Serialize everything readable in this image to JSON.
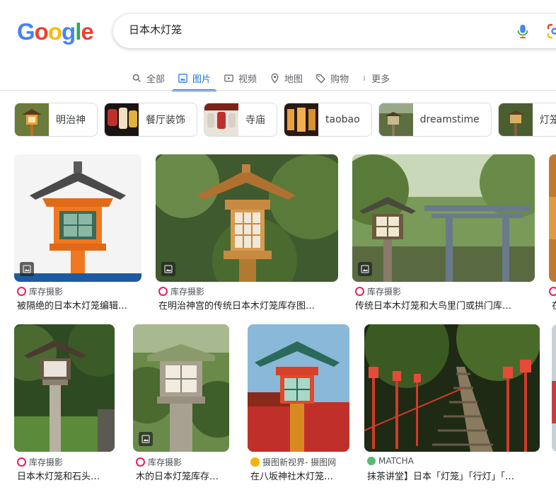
{
  "logo": {
    "letters": [
      "G",
      "o",
      "o",
      "g",
      "l",
      "e"
    ],
    "colors": [
      "#4285F4",
      "#EA4335",
      "#FBBC05",
      "#4285F4",
      "#34A853",
      "#EA4335"
    ]
  },
  "search": {
    "query": "日本木灯笼"
  },
  "tabs": [
    {
      "label": "全部",
      "icon": "search-icon"
    },
    {
      "label": "图片",
      "icon": "image-icon",
      "active": true
    },
    {
      "label": "视频",
      "icon": "video-icon"
    },
    {
      "label": "地图",
      "icon": "map-pin-icon"
    },
    {
      "label": "购物",
      "icon": "tag-icon"
    },
    {
      "label": "更多",
      "icon": "more-vert-icon"
    }
  ],
  "chips": [
    "明治神",
    "餐厅装饰",
    "寺庙",
    "taobao",
    "dreamstime",
    "灯笼库"
  ],
  "results": [
    {
      "source": "库存摄影",
      "title": "被隔绝的日本木灯笼编辑…"
    },
    {
      "source": "库存摄影",
      "title": "在明治神宫的传统日本木灯笼库存图…"
    },
    {
      "source": "库存摄影",
      "title": "传统日本木灯笼和大鸟里门或拱门库…"
    },
    {
      "source": "库",
      "title": "在"
    },
    {
      "source": "库存摄影",
      "title": "日本木灯笼和石头…"
    },
    {
      "source": "库存摄影",
      "title": "木的日本灯笼库存…"
    },
    {
      "source": "摄图新视界- 摄图网",
      "title": "在八坂神社木灯笼…"
    },
    {
      "source": "MATCHA",
      "title": "抹茶讲堂】日本「灯笼」「行灯」「…"
    }
  ],
  "colors": {
    "accent": "#1a73e8",
    "source_icon": "#e91e63",
    "matcha_icon": "#5bb974"
  }
}
